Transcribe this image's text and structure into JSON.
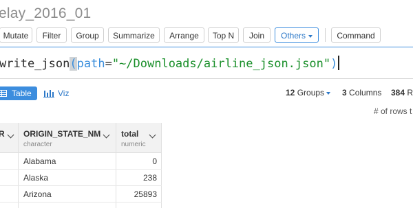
{
  "window": {
    "title": "elay_2016_01"
  },
  "toolbar": {
    "buttons": [
      "Mutate",
      "Filter",
      "Group",
      "Summarize",
      "Arrange",
      "Top N",
      "Join",
      "Others",
      "Command"
    ]
  },
  "command": {
    "fn": "write_json",
    "open_paren": "(",
    "arg_name": "path",
    "equals": "=",
    "arg_value": "\"~/Downloads/airline_json.json\"",
    "close_paren": ")"
  },
  "view": {
    "tab_table": "Table",
    "tab_viz": "Viz",
    "groups_count": "12",
    "groups_label": "Groups",
    "columns_count": "3",
    "columns_label": "Columns",
    "rows_count": "384",
    "rows_label": "R",
    "rows_note": "# of rows t"
  },
  "grid": {
    "columns": [
      {
        "name": "R",
        "type": ""
      },
      {
        "name": "ORIGIN_STATE_NM",
        "type": "character"
      },
      {
        "name": "total",
        "type": "numeric"
      }
    ],
    "rows": [
      {
        "state": "Alabama",
        "total": "0"
      },
      {
        "state": "Alaska",
        "total": "238"
      },
      {
        "state": "Arizona",
        "total": "25893"
      }
    ]
  },
  "colors": {
    "accent": "#3c8dde",
    "string": "#1a8f2a",
    "header_bg": "#f2f2f2"
  }
}
